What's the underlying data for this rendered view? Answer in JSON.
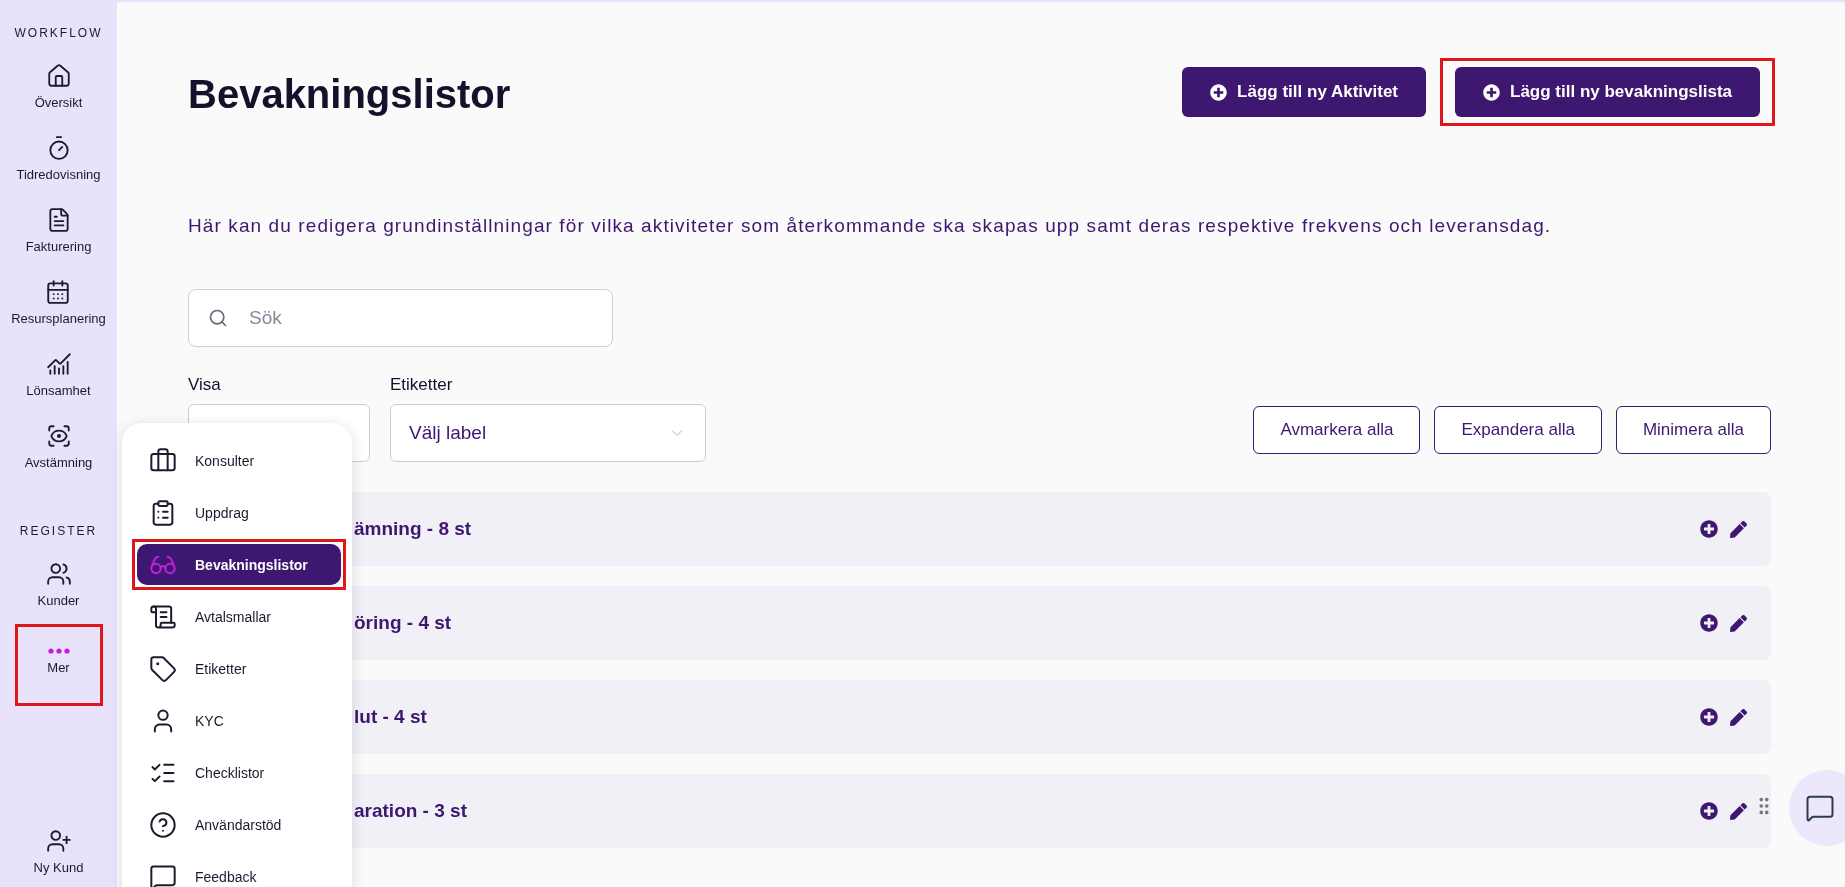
{
  "sidebar": {
    "sections": [
      {
        "heading": "WORKFLOW",
        "items": [
          {
            "kind": "home",
            "label": "Översikt",
            "highlighted": false
          },
          {
            "kind": "timer",
            "label": "Tidredovisning",
            "highlighted": false
          },
          {
            "kind": "file",
            "label": "Fakturering",
            "highlighted": false
          },
          {
            "kind": "calendar",
            "label": "Resursplanering",
            "highlighted": false
          },
          {
            "kind": "chart",
            "label": "Lönsamhet",
            "highlighted": false
          },
          {
            "kind": "eye",
            "label": "Avstämning",
            "highlighted": false
          }
        ]
      },
      {
        "heading": "REGISTER",
        "items": [
          {
            "kind": "users",
            "label": "Kunder",
            "highlighted": false
          },
          {
            "kind": "more",
            "label": "Mer",
            "highlighted": true
          }
        ]
      }
    ],
    "footer": {
      "kind": "user-plus",
      "label": "Ny Kund"
    }
  },
  "header": {
    "title": "Bevakningslistor",
    "buttons": [
      {
        "label": "Lägg till ny Aktivitet",
        "highlighted": false
      },
      {
        "label": "Lägg till ny bevakningslista",
        "highlighted": true
      }
    ]
  },
  "description": "Här kan du redigera grundinställningar för vilka aktiviteter som återkommande ska skapas upp samt deras respektive frekvens och leveransdag.",
  "search": {
    "placeholder": "Sök"
  },
  "filters": [
    {
      "label": "Visa"
    },
    {
      "label": "Etiketter",
      "placeholder": "Välj label"
    }
  ],
  "actions": [
    "Avmarkera alla",
    "Expandera alla",
    "Minimera alla"
  ],
  "lists": [
    {
      "title": "ämning - 8 st"
    },
    {
      "title": "öring - 4 st"
    },
    {
      "title": "lut - 4 st"
    },
    {
      "title": "aration - 3 st"
    }
  ],
  "more_menu": {
    "items": [
      {
        "kind": "briefcase",
        "label": "Konsulter",
        "selected": false,
        "highlighted": false
      },
      {
        "kind": "clipboard",
        "label": "Uppdrag",
        "selected": false,
        "highlighted": false
      },
      {
        "kind": "glasses",
        "label": "Bevakningslistor",
        "selected": true,
        "highlighted": true
      },
      {
        "kind": "scroll",
        "label": "Avtalsmallar",
        "selected": false,
        "highlighted": false
      },
      {
        "kind": "tag",
        "label": "Etiketter",
        "selected": false,
        "highlighted": false
      },
      {
        "kind": "user",
        "label": "KYC",
        "selected": false,
        "highlighted": false
      },
      {
        "kind": "checklist",
        "label": "Checklistor",
        "selected": false,
        "highlighted": false
      },
      {
        "kind": "help",
        "label": "Användarstöd",
        "selected": false,
        "highlighted": false
      },
      {
        "kind": "message",
        "label": "Feedback",
        "selected": false,
        "highlighted": false
      }
    ]
  }
}
